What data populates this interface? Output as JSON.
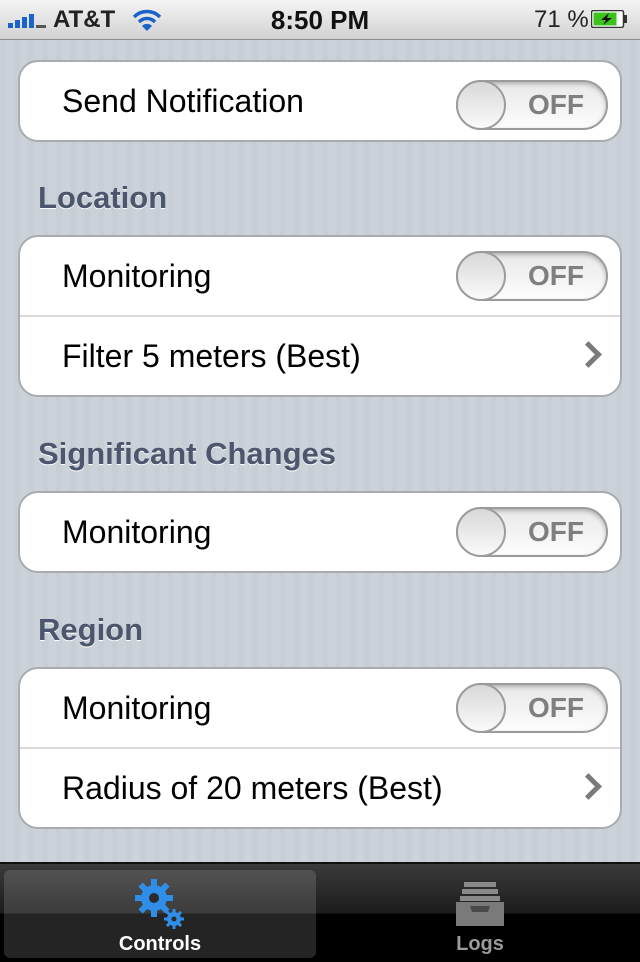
{
  "status_bar": {
    "carrier": "AT&T",
    "time": "8:50 PM",
    "battery_percent": "71 %",
    "icons": [
      "signal-icon",
      "wifi-icon",
      "battery-charging-icon"
    ]
  },
  "notification": {
    "label": "Send Notification",
    "toggle_text": "OFF",
    "on": false
  },
  "location": {
    "header": "Location",
    "monitoring_label": "Monitoring",
    "monitoring_toggle": "OFF",
    "monitoring_on": false,
    "filter_label": "Filter 5 meters (Best)"
  },
  "significant_changes": {
    "header": "Significant Changes",
    "monitoring_label": "Monitoring",
    "monitoring_toggle": "OFF",
    "monitoring_on": false
  },
  "region": {
    "header": "Region",
    "monitoring_label": "Monitoring",
    "monitoring_toggle": "OFF",
    "monitoring_on": false,
    "radius_label": "Radius of 20 meters (Best)"
  },
  "tab_bar": {
    "tabs": [
      {
        "label": "Controls",
        "icon": "gears-icon",
        "selected": true
      },
      {
        "label": "Logs",
        "icon": "inbox-tray-icon",
        "selected": false
      }
    ]
  },
  "colors": {
    "section_header": "#4c566c",
    "tab_selected_icon": "#2f8ee8",
    "signal": "#1a64c9",
    "battery_charge": "#3ec31d"
  }
}
